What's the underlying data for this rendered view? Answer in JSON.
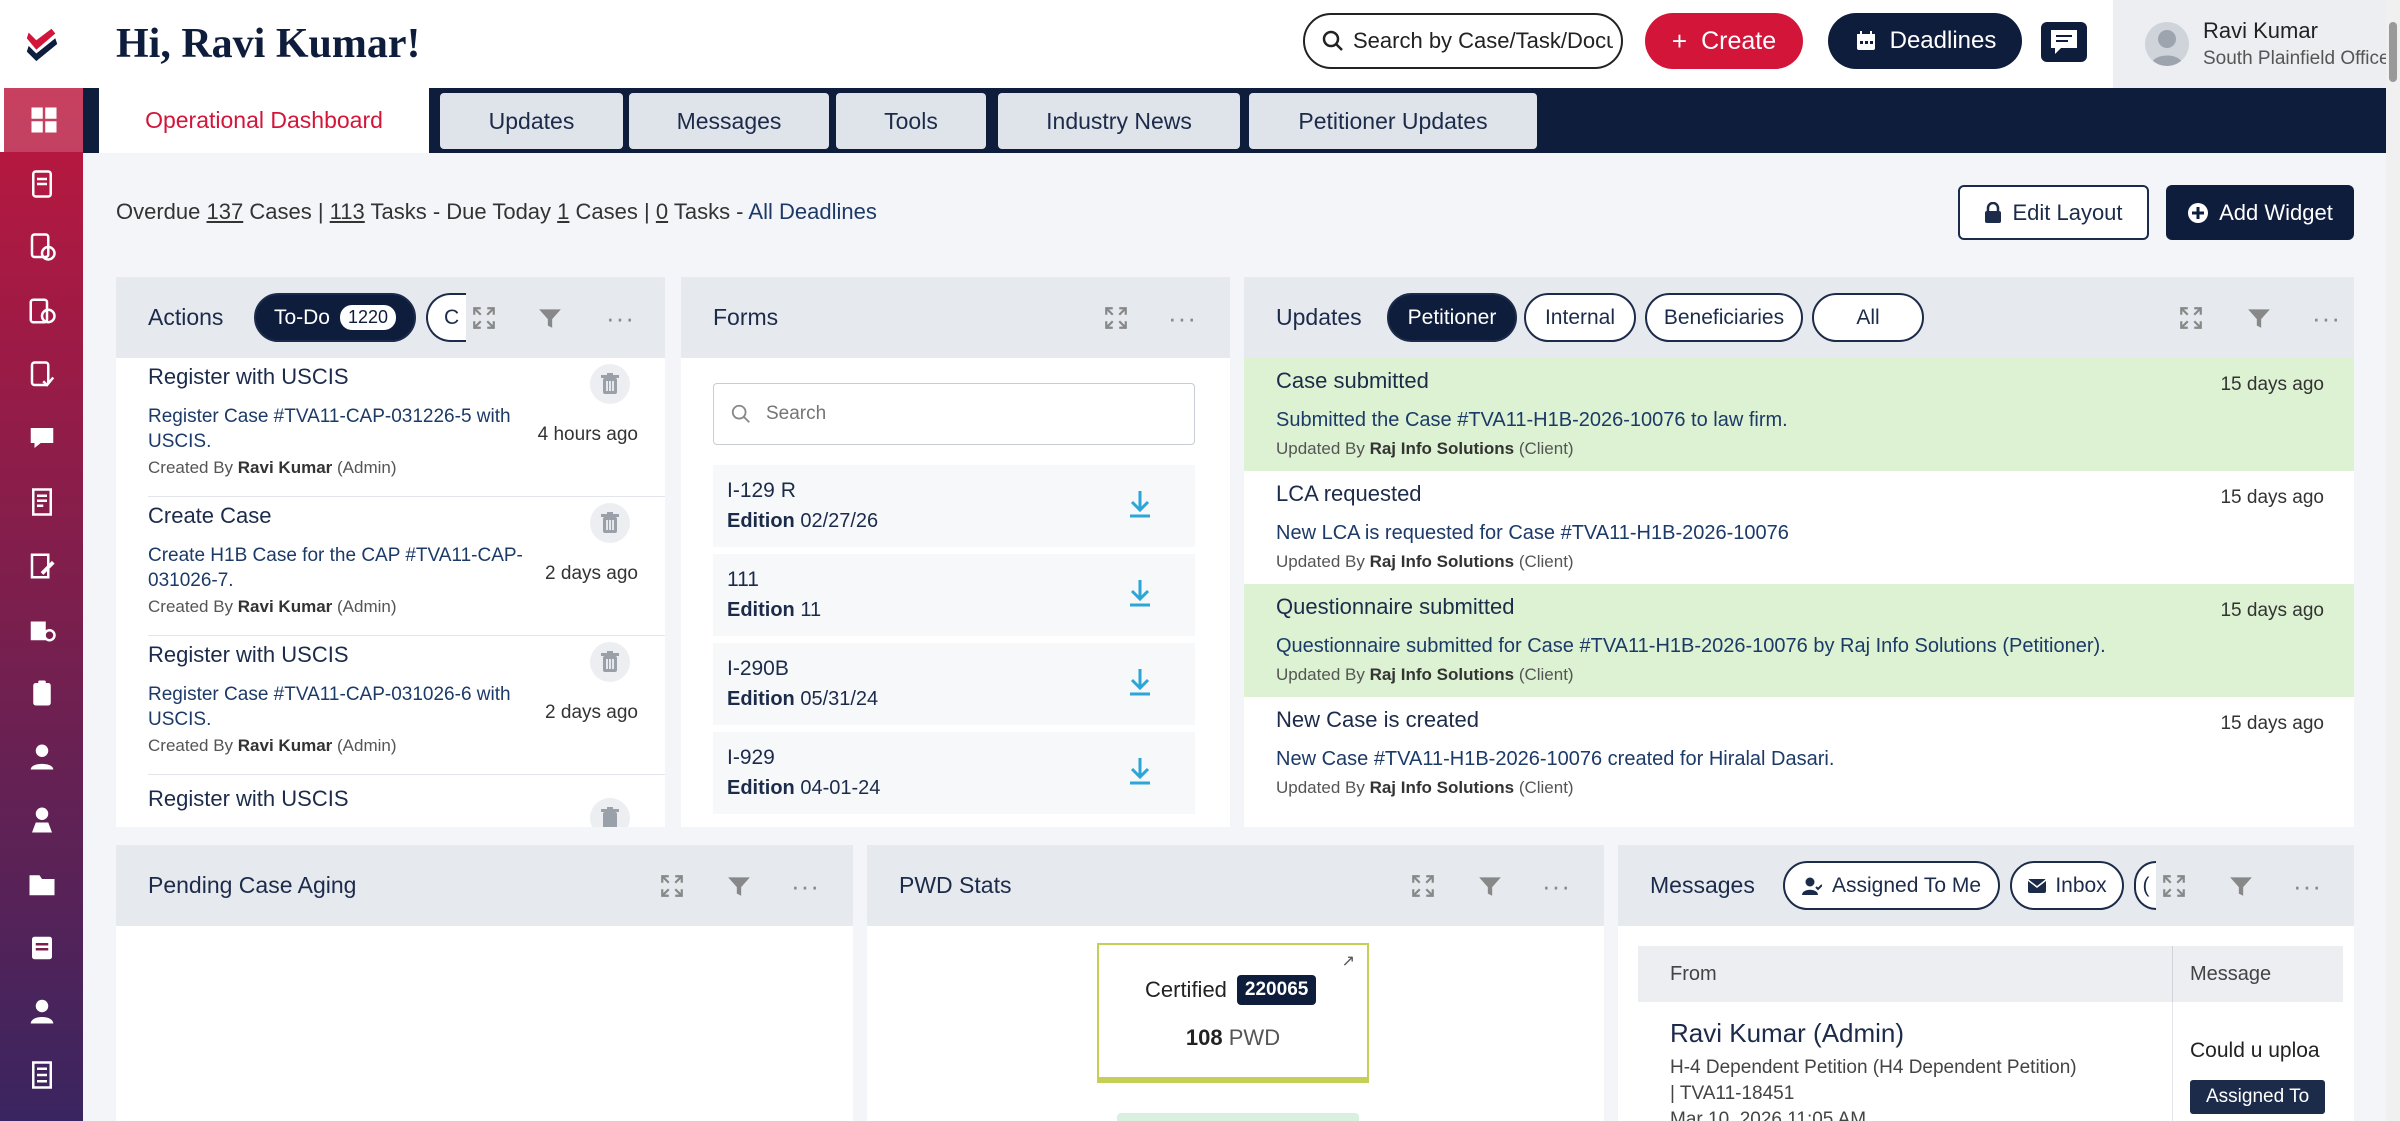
{
  "header": {
    "greeting": "Hi, Ravi Kumar!",
    "search_placeholder": "Search by Case/Task/Docu",
    "create_label": "Create",
    "deadlines_label": "Deadlines",
    "user_name": "Ravi Kumar",
    "user_office": "South Plainfield Office"
  },
  "tabs": [
    "Operational Dashboard",
    "Updates",
    "Messages",
    "Tools",
    "Industry News",
    "Petitioner Updates"
  ],
  "overdue": {
    "prefix": "Overdue",
    "cases_count": "137",
    "cases_word": "Cases |",
    "tasks_count": "113",
    "tasks_mid": "Tasks - Due Today",
    "today_cases": "1",
    "today_cases_word": "Cases |",
    "today_tasks": "0",
    "today_tasks_word": "Tasks -",
    "all_deadlines": "All Deadlines"
  },
  "buttons": {
    "edit_layout": "Edit Layout",
    "add_widget": "Add Widget"
  },
  "actions": {
    "title": "Actions",
    "todo_label": "To-Do",
    "todo_count": "1220",
    "partial_pill": "C",
    "items": [
      {
        "title": "Register with USCIS",
        "desc": "Register Case #TVA11-CAP-031226-5 with USCIS.",
        "created_by_label": "Created By",
        "created_by": "Ravi Kumar",
        "role": "(Admin)",
        "time": "4 hours ago"
      },
      {
        "title": "Create Case",
        "desc": "Create H1B Case for the CAP #TVA11-CAP-031026-7.",
        "created_by_label": "Created By",
        "created_by": "Ravi Kumar",
        "role": "(Admin)",
        "time": "2 days ago"
      },
      {
        "title": "Register with USCIS",
        "desc": "Register Case #TVA11-CAP-031026-6 with USCIS.",
        "created_by_label": "Created By",
        "created_by": "Ravi Kumar",
        "role": "(Admin)",
        "time": "2 days ago"
      },
      {
        "title": "Register with USCIS",
        "desc": "",
        "created_by_label": "",
        "created_by": "",
        "role": "",
        "time": ""
      }
    ]
  },
  "forms": {
    "title": "Forms",
    "search_placeholder": "Search",
    "items": [
      {
        "name": "I-129 R",
        "edition_label": "Edition",
        "edition": "02/27/26"
      },
      {
        "name": "111",
        "edition_label": "Edition",
        "edition": "11"
      },
      {
        "name": "I-290B",
        "edition_label": "Edition",
        "edition": "05/31/24"
      },
      {
        "name": "I-929",
        "edition_label": "Edition",
        "edition": "04-01-24"
      }
    ]
  },
  "updates": {
    "title": "Updates",
    "pills": [
      "Petitioner",
      "Internal",
      "Beneficiaries",
      "All"
    ],
    "items": [
      {
        "title": "Case submitted",
        "desc": "Submitted the Case #TVA11-H1B-2026-10076 to law firm.",
        "by_label": "Updated By",
        "by": "Raj Info Solutions",
        "role": "(Client)",
        "time": "15 days ago",
        "highlight": true
      },
      {
        "title": "LCA requested",
        "desc": "New LCA is requested for Case #TVA11-H1B-2026-10076",
        "by_label": "Updated By",
        "by": "Raj Info Solutions",
        "role": "(Client)",
        "time": "15 days ago",
        "highlight": false
      },
      {
        "title": "Questionnaire submitted",
        "desc": "Questionnaire submitted for Case #TVA11-H1B-2026-10076 by Raj Info Solutions (Petitioner).",
        "by_label": "Updated By",
        "by": "Raj Info Solutions",
        "role": "(Client)",
        "time": "15 days ago",
        "highlight": true
      },
      {
        "title": "New Case is created",
        "desc": "New Case #TVA11-H1B-2026-10076 created for Hiralal Dasari.",
        "by_label": "Updated By",
        "by": "Raj Info Solutions",
        "role": "(Client)",
        "time": "15 days ago",
        "highlight": false
      }
    ]
  },
  "aging": {
    "title": "Pending Case Aging"
  },
  "pwd": {
    "title": "PWD Stats",
    "certified_label": "Certified",
    "certified_count": "220065",
    "pwd_count": "108",
    "pwd_label": "PWD"
  },
  "messages": {
    "title": "Messages",
    "pill_assigned": "Assigned To Me",
    "pill_inbox": "Inbox",
    "partial_pill": "(",
    "col_from": "From",
    "col_message": "Message",
    "sender": "Ravi Kumar (Admin)",
    "subject": "H-4 Dependent Petition (H4 Dependent Petition)",
    "case_id": "| TVA11-18451",
    "date": "Mar 10, 2026 11:05 AM",
    "message_snippet": "Could u uploa",
    "assigned_btn": "Assigned To"
  },
  "colors": {
    "brand_red": "#d3153a",
    "navy": "#0f1d3d",
    "highlight_green": "#dcf2d2"
  }
}
